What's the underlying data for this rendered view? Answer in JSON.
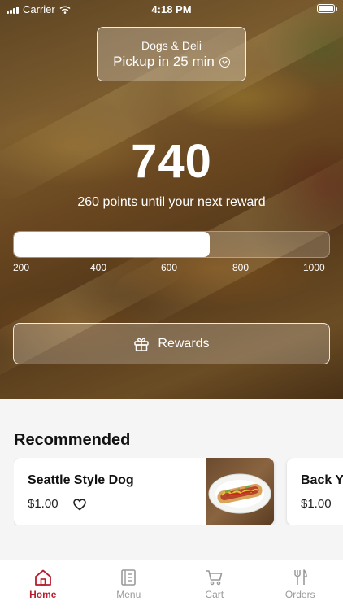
{
  "status_bar": {
    "carrier": "Carrier",
    "time": "4:18 PM"
  },
  "store": {
    "name": "Dogs & Deli",
    "pickup": "Pickup in 25 min"
  },
  "rewards": {
    "points": "740",
    "caption": "260 points until your next reward",
    "progress_fraction": 0.62,
    "ticks": [
      "200",
      "400",
      "600",
      "800",
      "1000"
    ],
    "button_label": "Rewards"
  },
  "recommended": {
    "title": "Recommended",
    "items": [
      {
        "name": "Seattle Style Dog",
        "price": "$1.00"
      },
      {
        "name": "Back Y",
        "price": "$1.00"
      }
    ]
  },
  "tab_bar": {
    "tabs": [
      {
        "label": "Home",
        "icon": "home-icon",
        "active": true
      },
      {
        "label": "Menu",
        "icon": "menu-icon",
        "active": false
      },
      {
        "label": "Cart",
        "icon": "cart-icon",
        "active": false
      },
      {
        "label": "Orders",
        "icon": "orders-icon",
        "active": false
      }
    ]
  },
  "colors": {
    "accent": "#b81d2e",
    "inactive": "#9a9a9a"
  }
}
